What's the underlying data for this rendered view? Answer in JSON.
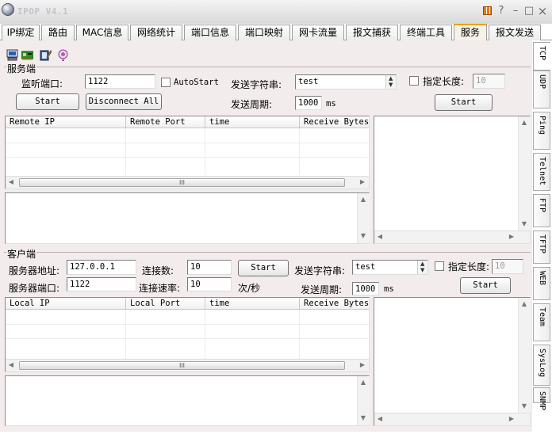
{
  "window": {
    "title": "IPOP V4.1",
    "help": "?",
    "minimize": "–",
    "maximize": "□",
    "close": "×"
  },
  "tabs": [
    "IP绑定",
    "路由",
    "MAC信息",
    "网络统计",
    "端口信息",
    "端口映射",
    "网卡流量",
    "报文捕获",
    "终端工具",
    "服务",
    "报文发送"
  ],
  "active_tab": "服务",
  "side_tabs": [
    "TCP",
    "UDP",
    "Ping",
    "Telnet",
    "FTP",
    "TFTP",
    "WEB",
    "Team",
    "SysLog",
    "SNMP"
  ],
  "active_side_tab": "TCP",
  "toolbar": {
    "icons": [
      "computer-icon",
      "network-card-icon",
      "edit-icon",
      "balloon-icon"
    ]
  },
  "server": {
    "group_label": "服务端",
    "listen_port_label": "监听端口:",
    "listen_port": "1122",
    "autostart_label": "AutoStart",
    "send_string_label": "发送字符串:",
    "send_string": "test",
    "fixed_length_label": "指定长度:",
    "fixed_length": "10",
    "send_period_label": "发送周期:",
    "send_period": "1000",
    "ms": "ms",
    "start_button": "Start",
    "disconnect_button": "Disconnect All",
    "send_start_button": "Start",
    "columns": [
      "Remote IP",
      "Remote Port",
      "time",
      "Receive Bytes"
    ]
  },
  "client": {
    "group_label": "客户端",
    "server_addr_label": "服务器地址:",
    "server_addr": "127.0.0.1",
    "conn_count_label": "连接数:",
    "conn_count": "10",
    "start_button": "Start",
    "send_string_label": "发送字符串:",
    "send_string": "test",
    "fixed_length_label": "指定长度:",
    "fixed_length": "10",
    "server_port_label": "服务器端口:",
    "server_port": "1122",
    "conn_rate_label": "连接速率:",
    "conn_rate": "10",
    "rate_unit": "次/秒",
    "send_period_label": "发送周期:",
    "send_period": "1000",
    "ms": "ms",
    "send_start_button": "Start",
    "columns": [
      "Local IP",
      "Local Port",
      "time",
      "Receive Bytes"
    ]
  },
  "scroll_glyphs": {
    "left": "◀",
    "right": "▶",
    "up": "▲",
    "down": "▼",
    "grip": "III"
  }
}
